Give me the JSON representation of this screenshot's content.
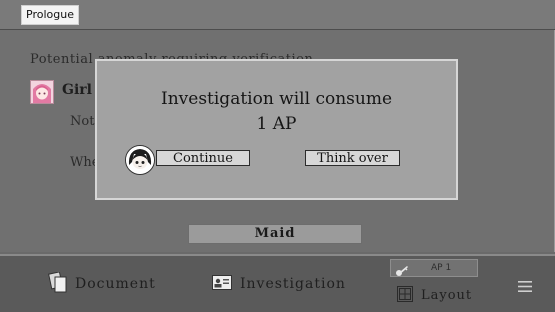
{
  "top_bar": {
    "chapter_label": "Prologue"
  },
  "log": {
    "line_1": "Potential anomaly requiring verification.",
    "speaker_name": "Girl",
    "line_2": "Not",
    "line_3": "Whe",
    "option_button": "Maid"
  },
  "modal": {
    "title": "Investigation will consume",
    "cost": "1 AP",
    "continue_label": "Continue",
    "think_over_label": "Think over"
  },
  "bottom_bar": {
    "document_label": "Document",
    "investigation_label": "Investigation",
    "ap_label": "AP 1",
    "layout_label": "Layout"
  },
  "colors": {
    "overlay": "#6a6a6a",
    "modal_bg": "#a2a2a2",
    "button_bg": "#d7d7d7",
    "avatar_pink": "#e8b6c9"
  }
}
